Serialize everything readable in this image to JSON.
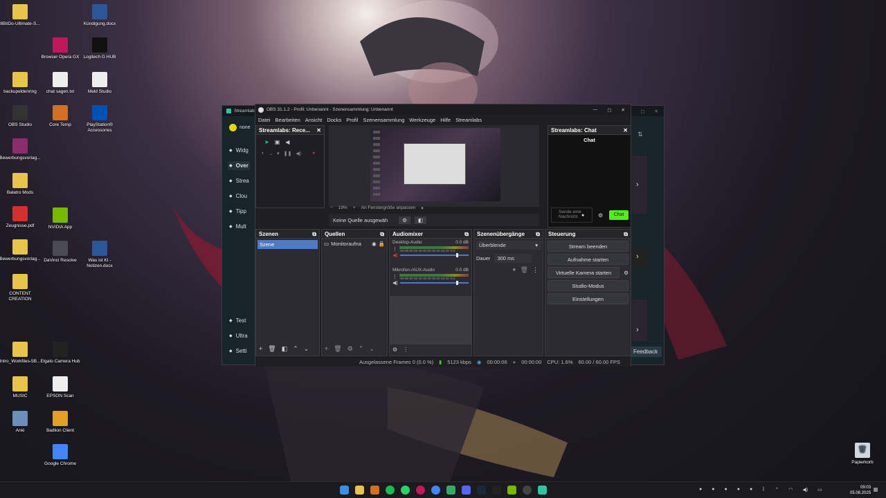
{
  "desktop_icons_left": [
    {
      "label": "8BitDo-Ultimate-S...",
      "icon": "folder-icon",
      "color": "#e8c44a"
    },
    {
      "label": "backupeldenring",
      "icon": "folder-icon",
      "color": "#e8c44a"
    },
    {
      "label": "OBS Studio",
      "icon": "obs-icon",
      "color": "#333"
    },
    {
      "label": "Bewerbungsvorlag...",
      "icon": "winrar-icon",
      "color": "#8b2d6a"
    },
    {
      "label": "Balatro Mods",
      "icon": "folder-icon",
      "color": "#e8c44a"
    },
    {
      "label": "Zeugnisse.pdf",
      "icon": "pdf-icon",
      "color": "#d32f2f"
    },
    {
      "label": "Bewerbungsvorlag...",
      "icon": "folder-icon",
      "color": "#e8c44a"
    },
    {
      "label": "CONTENT CREATION",
      "icon": "folder-icon",
      "color": "#e8c44a"
    },
    {
      "label": "Intro_Workfiles-5B...",
      "icon": "folder-icon",
      "color": "#e8c44a"
    },
    {
      "label": "MUSIC",
      "icon": "folder-icon",
      "color": "#e8c44a"
    },
    {
      "label": "Anki",
      "icon": "anki-icon",
      "color": "#6b8fb8"
    }
  ],
  "desktop_icons_mid": [
    {
      "label": "Browser Opera GX",
      "icon": "opera-icon",
      "color": "#c2185b"
    },
    {
      "label": "chat sagen.txt",
      "icon": "text-file-icon",
      "color": "#eee"
    },
    {
      "label": "Core Temp",
      "icon": "coretemp-icon",
      "color": "#d07020"
    },
    {
      "label": "NVIDIA App",
      "icon": "nvidia-icon",
      "color": "#76b900"
    },
    {
      "label": "DaVinci Resolve",
      "icon": "davinci-icon",
      "color": "#4a4a55"
    },
    {
      "label": "Elgato Camera Hub",
      "icon": "elgato-icon",
      "color": "#222"
    },
    {
      "label": "EPSON Scan",
      "icon": "epson-icon",
      "color": "#eee"
    },
    {
      "label": "Badlion Client",
      "icon": "badlion-icon",
      "color": "#e0a020"
    },
    {
      "label": "Google Chrome",
      "icon": "chrome-icon",
      "color": "#4285f4"
    }
  ],
  "desktop_icons_right": [
    {
      "label": "Kündigung.docx",
      "icon": "word-icon",
      "color": "#2b579a"
    },
    {
      "label": "Logitech G HUB",
      "icon": "logitech-icon",
      "color": "#111"
    },
    {
      "label": "Meld Studio",
      "icon": "file-icon",
      "color": "#eee"
    },
    {
      "label": "PlayStation® Accessories",
      "icon": "playstation-icon",
      "color": "#0050b5"
    },
    {
      "label": "Was ist KI - Notizen.docx",
      "icon": "word-icon",
      "color": "#2b579a"
    }
  ],
  "recycle_bin": {
    "label": "Papierkorb"
  },
  "streamlabs": {
    "title": "Streamlabs",
    "user": "none",
    "nav": [
      "Widg",
      "Over",
      "Strea",
      "Clou",
      "Tipp",
      "Mult",
      "Test",
      "Ultra",
      "Setti"
    ],
    "feedback": "Feedback"
  },
  "obs": {
    "title": "OBS 31.1.2 - Profil: Unbenannt - Szenensammlung: Unbenannt",
    "menu": [
      "Datei",
      "Bearbeiten",
      "Ansicht",
      "Docks",
      "Profil",
      "Szenensammlung",
      "Werkzeuge",
      "Hilfe",
      "Streamlabs"
    ],
    "recent_dock_title": "Streamlabs: Rece...",
    "chat_dock_title": "Streamlabs: Chat",
    "chat_header": "Chat",
    "chat_placeholder": "Sende eine Nachricht",
    "chat_button": "Chat",
    "zoom": "19%",
    "fit_label": "An Fenstergröße anpassen",
    "no_source": "Keine Quelle ausgewäh",
    "scenes": {
      "title": "Szenen",
      "items": [
        "Szene"
      ]
    },
    "sources": {
      "title": "Quellen",
      "items": [
        "Monitoraufna"
      ]
    },
    "audio": {
      "title": "Audiomixer",
      "channels": [
        {
          "name": "Desktop-Audio",
          "db": "0.0 dB",
          "level": 0.82
        },
        {
          "name": "Mikrofon-/AUX-Audio",
          "db": "0.0 dB",
          "level": 0.82
        }
      ],
      "scale": "-60-55-50-45-40-35-30-25-20-15-10 -5 0"
    },
    "transitions": {
      "title": "Szenenübergänge",
      "type": "Überblende",
      "duration_label": "Dauer",
      "duration": "300 ms"
    },
    "controls": {
      "title": "Steuerung",
      "buttons": [
        "Stream beenden",
        "Aufnahme starten",
        "Virtuelle Kamera starten",
        "Studio-Modus",
        "Einstellungen"
      ]
    },
    "status": {
      "dropped": "Ausgelassene Frames 0 (0.0 %)",
      "bitrate": "5123 kbps",
      "stream_time": "00:00:06",
      "rec_time": "00:00:00",
      "cpu": "CPU: 1.6%",
      "fps": "60.00 / 60.00 FPS"
    }
  },
  "tray": {
    "time": "09:03",
    "date": "05.08.2025"
  }
}
